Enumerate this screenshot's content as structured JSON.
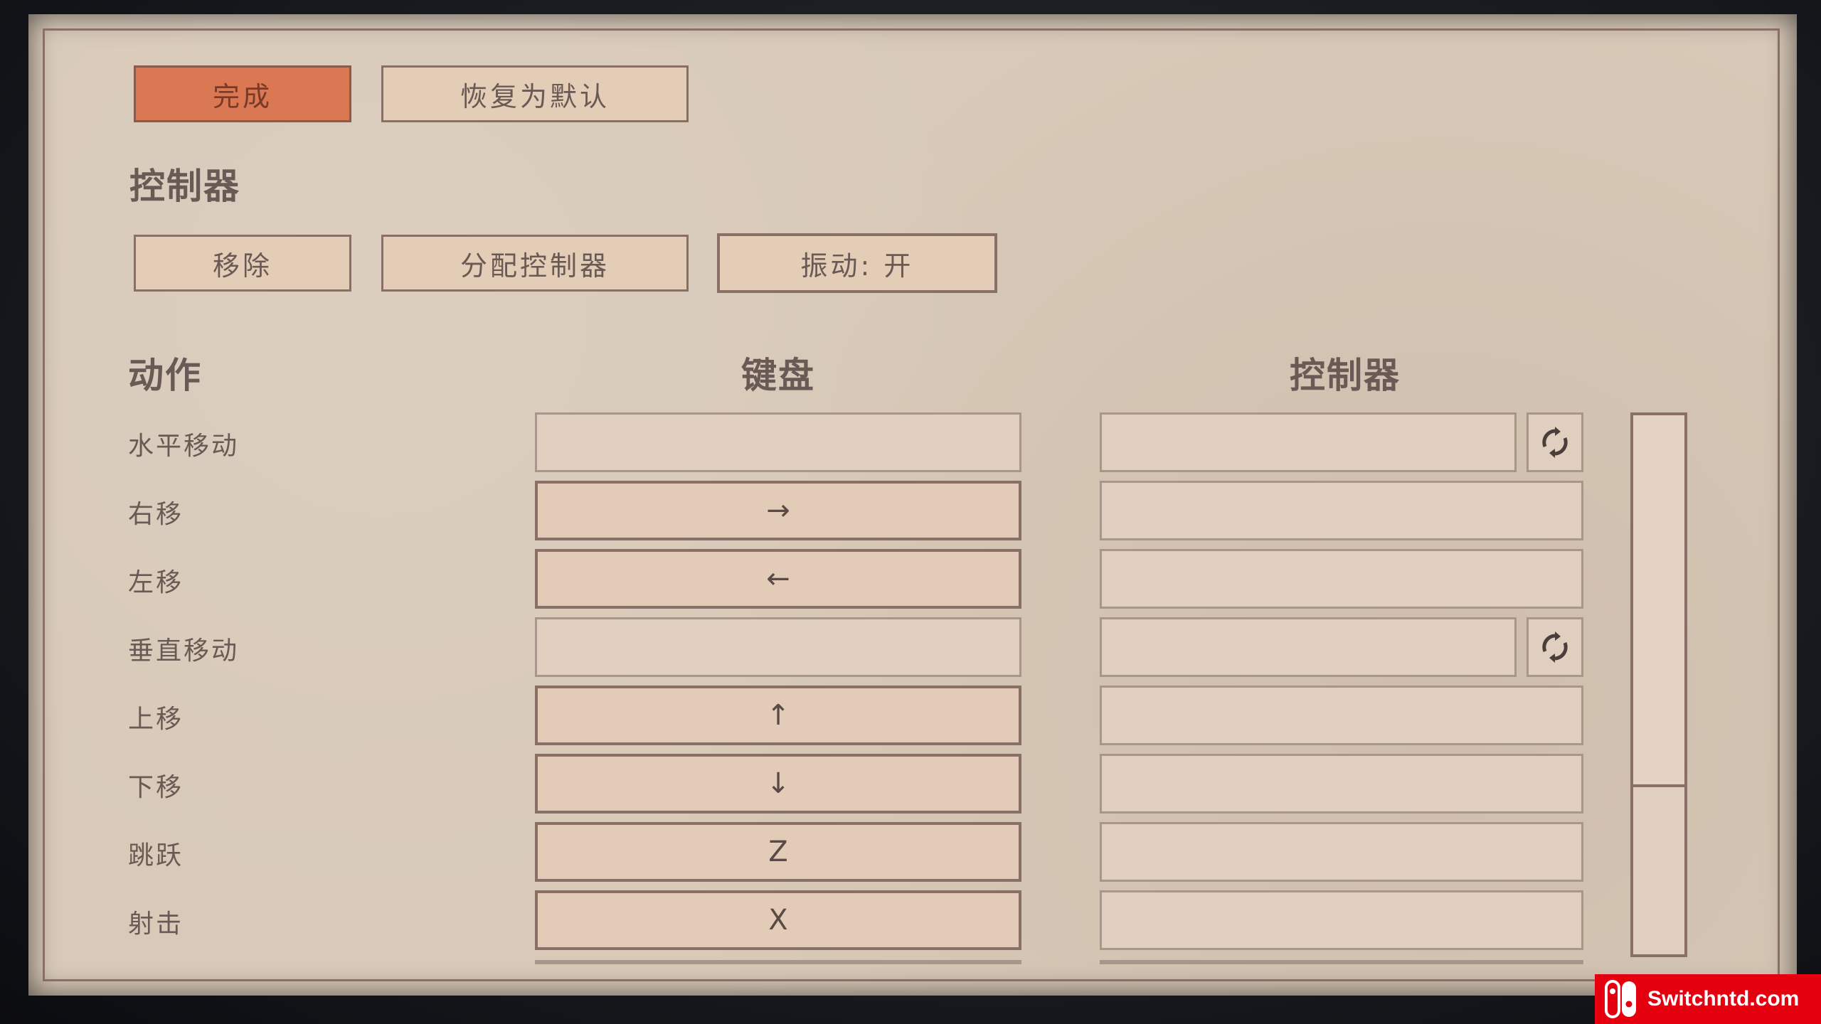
{
  "top_buttons": {
    "done": "完成",
    "restore_default": "恢复为默认"
  },
  "controller_section": {
    "title": "控制器",
    "remove": "移除",
    "assign_controller": "分配控制器",
    "vibration": "振动: 开"
  },
  "columns": {
    "action": "动作",
    "keyboard": "键盘",
    "controller": "控制器"
  },
  "rows": [
    {
      "action": "水平移动",
      "keyboard": "",
      "controller": "",
      "has_reset": true,
      "reset_icon": "cycle-icon"
    },
    {
      "action": "右移",
      "keyboard": "→",
      "controller": "",
      "has_reset": false
    },
    {
      "action": "左移",
      "keyboard": "←",
      "controller": "",
      "has_reset": false
    },
    {
      "action": "垂直移动",
      "keyboard": "",
      "controller": "",
      "has_reset": true,
      "reset_icon": "cycle-icon"
    },
    {
      "action": "上移",
      "keyboard": "↑",
      "controller": "",
      "has_reset": false
    },
    {
      "action": "下移",
      "keyboard": "↓",
      "controller": "",
      "has_reset": false
    },
    {
      "action": "跳跃",
      "keyboard": "Z",
      "controller": "",
      "has_reset": false
    },
    {
      "action": "射击",
      "keyboard": "X",
      "controller": "",
      "has_reset": false
    }
  ],
  "scrollbar": {
    "position_fraction": 0.0,
    "visible_fraction": 0.69
  },
  "watermark": {
    "text": "Switchntd.com",
    "brand_color": "#e4000f"
  },
  "colors": {
    "paper": "#d8c9b8",
    "accent_button": "#d97852",
    "ink": "#6a5a55",
    "border": "#8a6f66"
  }
}
